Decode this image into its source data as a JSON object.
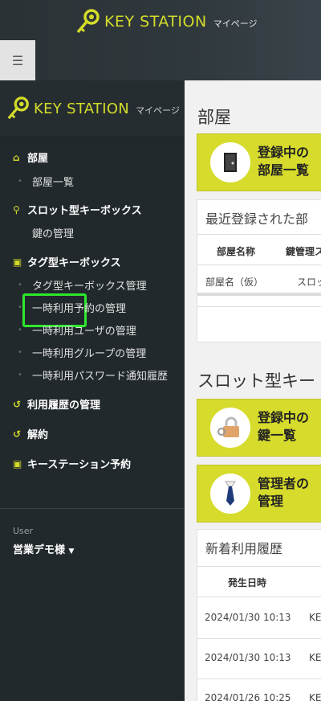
{
  "header": {
    "brand": "KEY STATION",
    "subtitle": "マイページ",
    "menu_icon": "hamburger-icon"
  },
  "sidebar": {
    "brand": "KEY STATION",
    "subtitle": "マイページ",
    "sections": [
      {
        "label": "部屋",
        "icon": "home-icon",
        "items": [
          "部屋一覧"
        ]
      },
      {
        "label": "スロット型キーボックス",
        "icon": "key-icon",
        "items": [
          "鍵の管理"
        ]
      },
      {
        "label": "タグ型キーボックス",
        "icon": "archive-icon",
        "items": [
          "タグ型キーボックス管理",
          "一時利用予約の管理",
          "一時利用ユーザの管理",
          "一時利用グループの管理",
          "一時利用パスワード通知履歴"
        ]
      },
      {
        "label": "利用履歴の管理",
        "icon": "history-icon",
        "items": []
      },
      {
        "label": "解約",
        "icon": "undo-icon",
        "items": []
      },
      {
        "label": "キーステーション予約",
        "icon": "archive-icon",
        "items": []
      }
    ],
    "active_item": "鍵の管理",
    "user_label": "User",
    "user_name": "営業デモ様"
  },
  "main": {
    "room_heading": "部屋",
    "room_tile": [
      "登録中の",
      "部屋一覧"
    ],
    "recent_panel": {
      "title": "最近登録された部",
      "headers": [
        "部屋名称",
        "鍵管理ス"
      ],
      "rows": [
        [
          "部屋名（仮）",
          "スロッ"
        ]
      ]
    },
    "slot_heading": "スロット型キー",
    "key_tile": [
      "登録中の",
      "鍵一覧"
    ],
    "admin_tile": [
      "管理者の",
      "管理"
    ],
    "history_panel": {
      "title": "新着利用履歴",
      "headers": [
        "発生日時"
      ],
      "rows": [
        [
          "2024/01/30 10:13",
          "KE"
        ],
        [
          "2024/01/30 10:13",
          "KE"
        ],
        [
          "2024/01/26 10:25",
          "KE"
        ]
      ]
    }
  },
  "colors": {
    "accent": "#d6db2c",
    "sidebar_bg": "#22292d",
    "active_highlight": "#2ee82e"
  }
}
